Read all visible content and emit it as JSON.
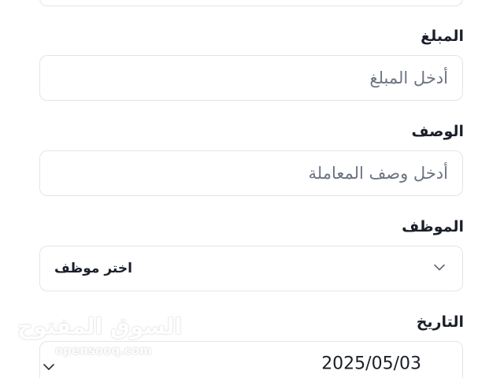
{
  "form": {
    "amount": {
      "label": "المبلغ",
      "placeholder": "أدخل المبلغ"
    },
    "description": {
      "label": "الوصف",
      "placeholder": "أدخل وصف المعاملة"
    },
    "employee": {
      "label": "الموظف",
      "selected": "اختر موظف",
      "icon": "chevron-down-icon"
    },
    "date": {
      "label": "التاريخ",
      "value": "2025/05/03",
      "icon": "chevron-down-icon"
    }
  },
  "watermark": {
    "arabic": "السوق المفتوح",
    "latin": "opensooq.com"
  },
  "colors": {
    "border": "#e2e5ea",
    "label_text": "#1a1f29",
    "placeholder_text": "#6b7482"
  }
}
